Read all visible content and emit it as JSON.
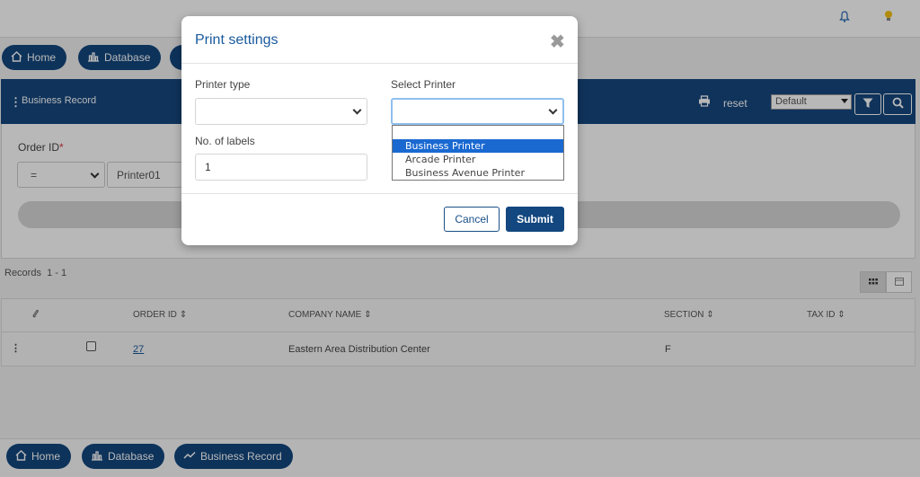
{
  "nav": {
    "home": "Home",
    "database": "Database",
    "business_record": "Business Record"
  },
  "panel": {
    "title": "Business Record",
    "reset_label": "reset",
    "view_select": "Default"
  },
  "filter": {
    "order_id_label": "Order ID",
    "required_mark": "*",
    "operator": "=",
    "value": "Printer01"
  },
  "records": {
    "label": "Records",
    "range": "1 - 1"
  },
  "table": {
    "headers": [
      "ORDER ID",
      "COMPANY NAME",
      "SECTION",
      "TAX ID"
    ],
    "sort_glyph": "⇕",
    "rows": [
      {
        "order_id": "27",
        "company_name": "Eastern Area Distribution Center",
        "section": "F",
        "tax_id": ""
      }
    ]
  },
  "modal": {
    "title": "Print settings",
    "close_glyph": "✖",
    "printer_type_label": "Printer type",
    "printer_type_value": "",
    "select_printer_label": "Select Printer",
    "select_printer_value": "",
    "labels_count_label": "No. of labels",
    "labels_count_value": "1",
    "printer_options": [
      "",
      "Business Printer",
      "Arcade Printer",
      "Business Avenue Printer"
    ],
    "highlighted_option": "Business Printer",
    "cancel_label": "Cancel",
    "submit_label": "Submit"
  },
  "colors": {
    "brand": "#13477f",
    "title_blue": "#1a5a9e",
    "highlight": "#1a69d1",
    "required": "#d9363e"
  },
  "icons": [
    "bell-icon",
    "bulb-icon",
    "home-icon",
    "database-icon",
    "trend-icon",
    "print-icon",
    "filter-icon",
    "search-icon",
    "grid-icon",
    "calendar-icon",
    "paperclip-icon",
    "kebab-icon",
    "close-icon"
  ]
}
